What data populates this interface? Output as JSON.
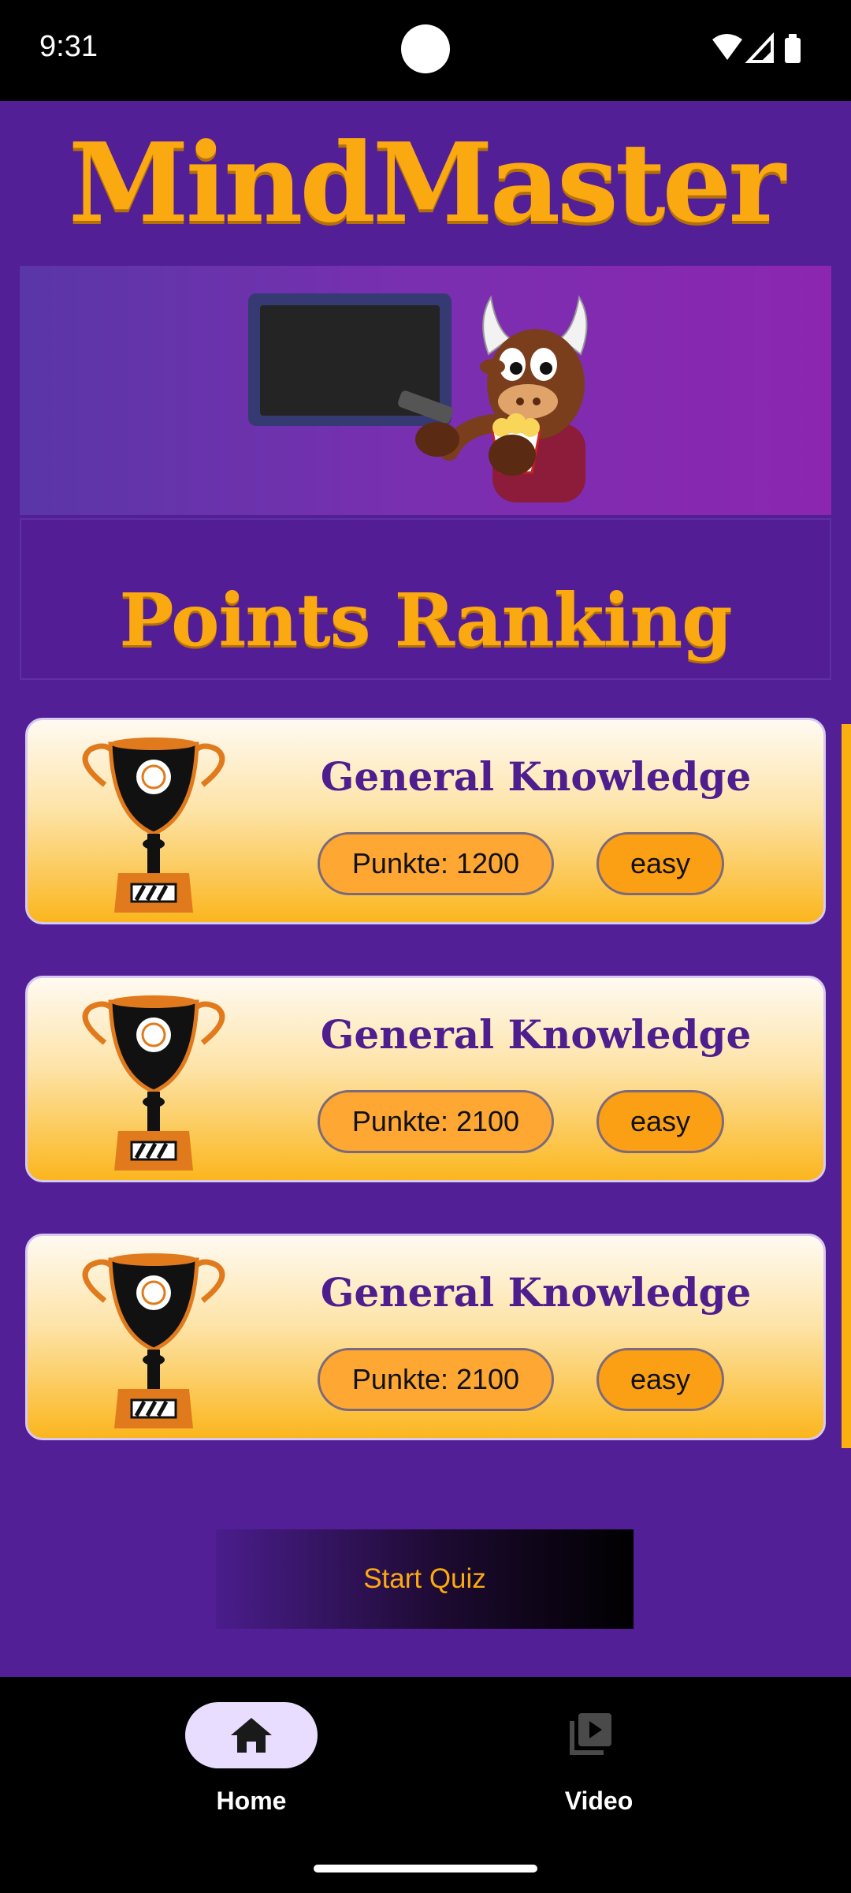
{
  "status_bar": {
    "time": "9:31"
  },
  "header": {
    "app_title": "MindMaster"
  },
  "ranking": {
    "title": "Points Ranking",
    "cards": [
      {
        "title": "General Knowledge",
        "points": "Punkte: 1200",
        "difficulty": "easy"
      },
      {
        "title": "General Knowledge",
        "points": "Punkte: 2100",
        "difficulty": "easy"
      },
      {
        "title": "General Knowledge",
        "points": "Punkte: 2100",
        "difficulty": "easy"
      }
    ]
  },
  "actions": {
    "start_label": "Start Quiz"
  },
  "bottom_nav": {
    "items": [
      {
        "label": "Home",
        "icon": "home-icon",
        "selected": true
      },
      {
        "label": "Video",
        "icon": "video-library-icon",
        "selected": false
      }
    ]
  },
  "colors": {
    "background": "#521f96",
    "accent": "#fba910",
    "card_bottom": "#fbb61e",
    "nav_selected": "#e9ddff"
  }
}
